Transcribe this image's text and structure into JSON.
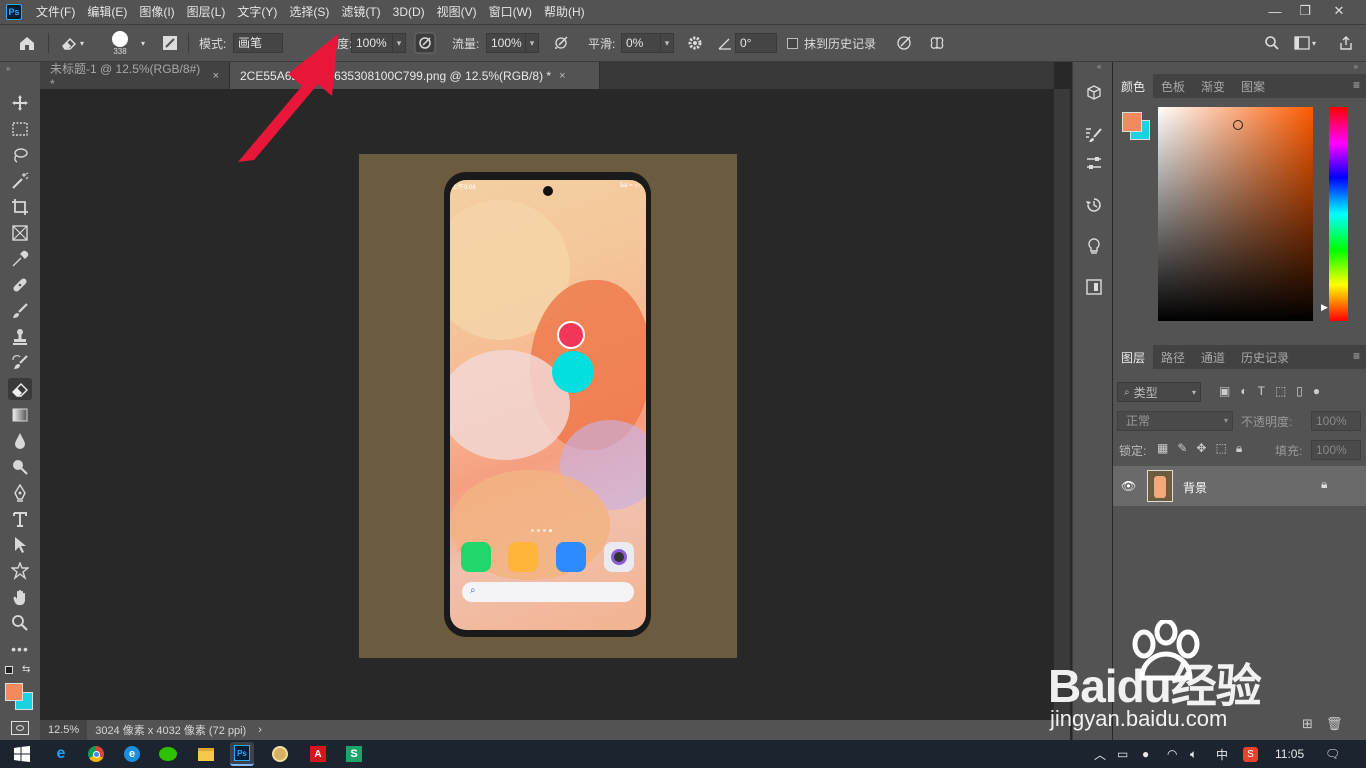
{
  "menubar": {
    "app_logo": "Ps",
    "items": [
      "文件(F)",
      "编辑(E)",
      "图像(I)",
      "图层(L)",
      "文字(Y)",
      "选择(S)",
      "滤镜(T)",
      "3D(D)",
      "视图(V)",
      "窗口(W)",
      "帮助(H)"
    ],
    "window_controls": {
      "minimize": "—",
      "restore": "❐",
      "close": "✕"
    }
  },
  "options": {
    "brush_size": "338",
    "mode_label": "模式:",
    "mode_value": "画笔",
    "opacity_label": "度:",
    "opacity_value": "100%",
    "flow_label": "流量:",
    "flow_value": "100%",
    "smoothing_label": "平滑:",
    "smoothing_value": "0%",
    "angle_value": "0°",
    "erase_history_label": "抹到历史记录"
  },
  "tabs": [
    {
      "title": "未标题-1 @ 12.5%(RGB/8#) *",
      "close": "×"
    },
    {
      "title": "2CE55A6B163E9635308100C799.png @ 12.5%(RGB/8) *",
      "close": "×"
    }
  ],
  "phone_screen": {
    "status_time": "上午9:08",
    "status_right": "5al ≈ ▭"
  },
  "statusbar": {
    "zoom": "12.5%",
    "doc_info": "3024 像素 x 4032 像素 (72 ppi)",
    "arrow": "›"
  },
  "color_panel": {
    "tabs": [
      "颜色",
      "色板",
      "渐变",
      "图案"
    ],
    "foreground": "#f4895e",
    "background": "#1ad3e0",
    "hue_base": "#ff5a00"
  },
  "layers_panel": {
    "tabs": [
      "图层",
      "路径",
      "通道",
      "历史记录"
    ],
    "filter_label": "类型",
    "blend_mode": "正常",
    "opacity_label": "不透明度:",
    "opacity_value": "100%",
    "lock_label": "锁定:",
    "fill_label": "填充:",
    "fill_value": "100%",
    "layers": [
      {
        "name": "背景",
        "visible": true,
        "locked": true
      }
    ]
  },
  "taskbar": {
    "apps": [
      "ie",
      "chrome",
      "edge",
      "wechat",
      "explorer",
      "photoshop",
      "pinball",
      "acrobat",
      "s-app"
    ],
    "tray_ime": "中",
    "tray_s": "S",
    "clock": "11:05"
  },
  "watermark": {
    "brand": "Baidu经验",
    "url": "jingyan.baidu.com"
  },
  "colors": {
    "accent_arrow": "#e8173a",
    "ps_blue": "#31a8ff",
    "panel_bg": "#535353",
    "canvas_bg": "#282828"
  }
}
